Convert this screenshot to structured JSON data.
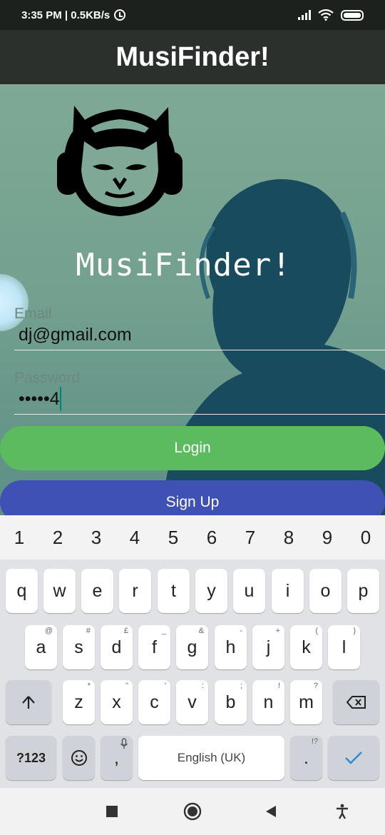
{
  "status_bar": {
    "time_speed": "3:35 PM | 0.5KB/s"
  },
  "app_bar": {
    "title": "MusiFinder!"
  },
  "hero": {
    "title": "MusiFinder!"
  },
  "email": {
    "label": "Email",
    "value": "dj@gmail.com"
  },
  "password": {
    "label": "Password",
    "value": "•••••4"
  },
  "buttons": {
    "login": "Login",
    "signup": "Sign Up"
  },
  "keyboard": {
    "numbers": [
      "1",
      "2",
      "3",
      "4",
      "5",
      "6",
      "7",
      "8",
      "9",
      "0"
    ],
    "row1": [
      "q",
      "w",
      "e",
      "r",
      "t",
      "y",
      "u",
      "i",
      "o",
      "p"
    ],
    "row2": [
      "a",
      "s",
      "d",
      "f",
      "g",
      "h",
      "j",
      "k",
      "l"
    ],
    "row2_hints": [
      "@",
      "#",
      "£",
      "_",
      "&",
      "-",
      "+",
      "(",
      ")"
    ],
    "row3": [
      "z",
      "x",
      "c",
      "v",
      "b",
      "n",
      "m"
    ],
    "row3_hints": [
      "*",
      "\"",
      "'",
      ":",
      ";",
      "!",
      "?"
    ],
    "sym_label": "?123",
    "comma": ",",
    "space_label": "English (UK)",
    "period": ".",
    "period_hint": "!?"
  },
  "colors": {
    "login": "#5bbb5e",
    "signup": "#3f51b5",
    "app_bar": "#2c302d"
  }
}
